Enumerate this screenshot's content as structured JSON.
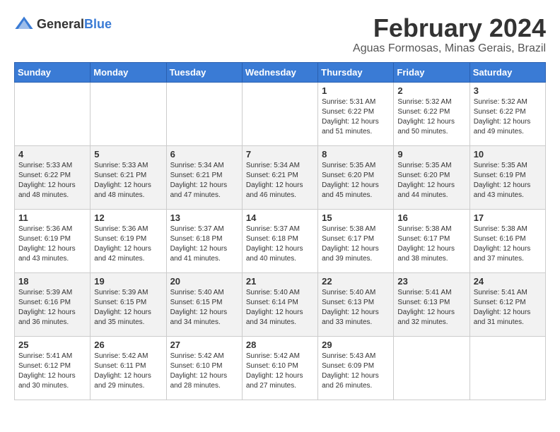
{
  "header": {
    "logo_general": "General",
    "logo_blue": "Blue",
    "title": "February 2024",
    "subtitle": "Aguas Formosas, Minas Gerais, Brazil"
  },
  "days_of_week": [
    "Sunday",
    "Monday",
    "Tuesday",
    "Wednesday",
    "Thursday",
    "Friday",
    "Saturday"
  ],
  "weeks": [
    [
      {
        "num": "",
        "info": ""
      },
      {
        "num": "",
        "info": ""
      },
      {
        "num": "",
        "info": ""
      },
      {
        "num": "",
        "info": ""
      },
      {
        "num": "1",
        "info": "Sunrise: 5:31 AM\nSunset: 6:22 PM\nDaylight: 12 hours\nand 51 minutes."
      },
      {
        "num": "2",
        "info": "Sunrise: 5:32 AM\nSunset: 6:22 PM\nDaylight: 12 hours\nand 50 minutes."
      },
      {
        "num": "3",
        "info": "Sunrise: 5:32 AM\nSunset: 6:22 PM\nDaylight: 12 hours\nand 49 minutes."
      }
    ],
    [
      {
        "num": "4",
        "info": "Sunrise: 5:33 AM\nSunset: 6:22 PM\nDaylight: 12 hours\nand 48 minutes."
      },
      {
        "num": "5",
        "info": "Sunrise: 5:33 AM\nSunset: 6:21 PM\nDaylight: 12 hours\nand 48 minutes."
      },
      {
        "num": "6",
        "info": "Sunrise: 5:34 AM\nSunset: 6:21 PM\nDaylight: 12 hours\nand 47 minutes."
      },
      {
        "num": "7",
        "info": "Sunrise: 5:34 AM\nSunset: 6:21 PM\nDaylight: 12 hours\nand 46 minutes."
      },
      {
        "num": "8",
        "info": "Sunrise: 5:35 AM\nSunset: 6:20 PM\nDaylight: 12 hours\nand 45 minutes."
      },
      {
        "num": "9",
        "info": "Sunrise: 5:35 AM\nSunset: 6:20 PM\nDaylight: 12 hours\nand 44 minutes."
      },
      {
        "num": "10",
        "info": "Sunrise: 5:35 AM\nSunset: 6:19 PM\nDaylight: 12 hours\nand 43 minutes."
      }
    ],
    [
      {
        "num": "11",
        "info": "Sunrise: 5:36 AM\nSunset: 6:19 PM\nDaylight: 12 hours\nand 43 minutes."
      },
      {
        "num": "12",
        "info": "Sunrise: 5:36 AM\nSunset: 6:19 PM\nDaylight: 12 hours\nand 42 minutes."
      },
      {
        "num": "13",
        "info": "Sunrise: 5:37 AM\nSunset: 6:18 PM\nDaylight: 12 hours\nand 41 minutes."
      },
      {
        "num": "14",
        "info": "Sunrise: 5:37 AM\nSunset: 6:18 PM\nDaylight: 12 hours\nand 40 minutes."
      },
      {
        "num": "15",
        "info": "Sunrise: 5:38 AM\nSunset: 6:17 PM\nDaylight: 12 hours\nand 39 minutes."
      },
      {
        "num": "16",
        "info": "Sunrise: 5:38 AM\nSunset: 6:17 PM\nDaylight: 12 hours\nand 38 minutes."
      },
      {
        "num": "17",
        "info": "Sunrise: 5:38 AM\nSunset: 6:16 PM\nDaylight: 12 hours\nand 37 minutes."
      }
    ],
    [
      {
        "num": "18",
        "info": "Sunrise: 5:39 AM\nSunset: 6:16 PM\nDaylight: 12 hours\nand 36 minutes."
      },
      {
        "num": "19",
        "info": "Sunrise: 5:39 AM\nSunset: 6:15 PM\nDaylight: 12 hours\nand 35 minutes."
      },
      {
        "num": "20",
        "info": "Sunrise: 5:40 AM\nSunset: 6:15 PM\nDaylight: 12 hours\nand 34 minutes."
      },
      {
        "num": "21",
        "info": "Sunrise: 5:40 AM\nSunset: 6:14 PM\nDaylight: 12 hours\nand 34 minutes."
      },
      {
        "num": "22",
        "info": "Sunrise: 5:40 AM\nSunset: 6:13 PM\nDaylight: 12 hours\nand 33 minutes."
      },
      {
        "num": "23",
        "info": "Sunrise: 5:41 AM\nSunset: 6:13 PM\nDaylight: 12 hours\nand 32 minutes."
      },
      {
        "num": "24",
        "info": "Sunrise: 5:41 AM\nSunset: 6:12 PM\nDaylight: 12 hours\nand 31 minutes."
      }
    ],
    [
      {
        "num": "25",
        "info": "Sunrise: 5:41 AM\nSunset: 6:12 PM\nDaylight: 12 hours\nand 30 minutes."
      },
      {
        "num": "26",
        "info": "Sunrise: 5:42 AM\nSunset: 6:11 PM\nDaylight: 12 hours\nand 29 minutes."
      },
      {
        "num": "27",
        "info": "Sunrise: 5:42 AM\nSunset: 6:10 PM\nDaylight: 12 hours\nand 28 minutes."
      },
      {
        "num": "28",
        "info": "Sunrise: 5:42 AM\nSunset: 6:10 PM\nDaylight: 12 hours\nand 27 minutes."
      },
      {
        "num": "29",
        "info": "Sunrise: 5:43 AM\nSunset: 6:09 PM\nDaylight: 12 hours\nand 26 minutes."
      },
      {
        "num": "",
        "info": ""
      },
      {
        "num": "",
        "info": ""
      }
    ]
  ]
}
